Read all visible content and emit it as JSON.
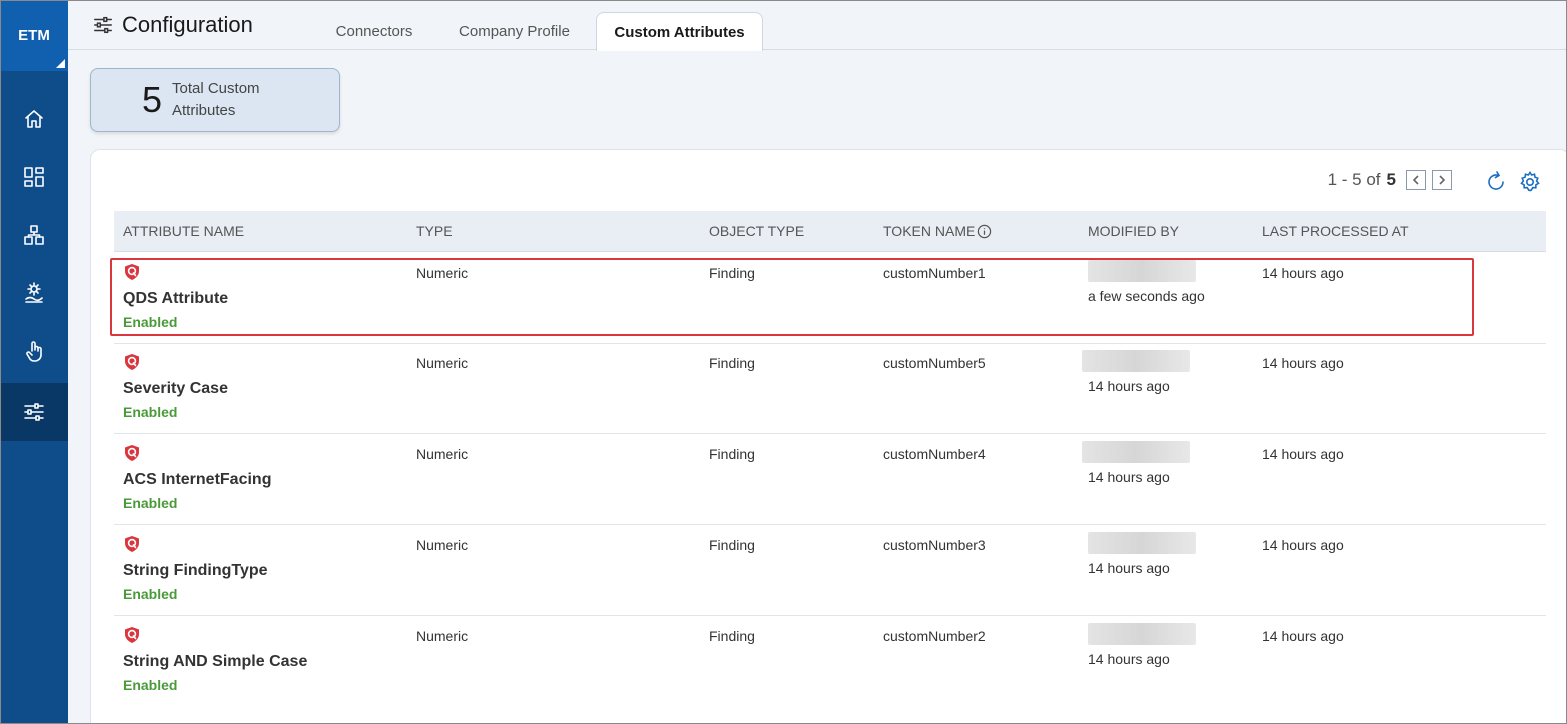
{
  "brand": "ETM",
  "header": {
    "title": "Configuration"
  },
  "tabs": [
    {
      "label": "Connectors",
      "active": false
    },
    {
      "label": "Company Profile",
      "active": false
    },
    {
      "label": "Custom Attributes",
      "active": true
    }
  ],
  "stat": {
    "value": "5",
    "label": "Total Custom Attributes"
  },
  "pager": {
    "range": "1 - 5 of",
    "total": "5"
  },
  "columns": [
    "ATTRIBUTE NAME",
    "TYPE",
    "OBJECT TYPE",
    "TOKEN NAME",
    "MODIFIED BY",
    "LAST PROCESSED AT"
  ],
  "rows": [
    {
      "name": "QDS Attribute",
      "status": "Enabled",
      "type": "Numeric",
      "object_type": "Finding",
      "token": "customNumber1",
      "modified": "a few seconds ago",
      "processed": "14 hours ago"
    },
    {
      "name": "Severity Case",
      "status": "Enabled",
      "type": "Numeric",
      "object_type": "Finding",
      "token": "customNumber5",
      "modified": "14 hours ago",
      "processed": "14 hours ago"
    },
    {
      "name": "ACS InternetFacing",
      "status": "Enabled",
      "type": "Numeric",
      "object_type": "Finding",
      "token": "customNumber4",
      "modified": "14 hours ago",
      "processed": "14 hours ago"
    },
    {
      "name": "String FindingType",
      "status": "Enabled",
      "type": "Numeric",
      "object_type": "Finding",
      "token": "customNumber3",
      "modified": "14 hours ago",
      "processed": "14 hours ago"
    },
    {
      "name": "String AND Simple Case",
      "status": "Enabled",
      "type": "Numeric",
      "object_type": "Finding",
      "token": "customNumber2",
      "modified": "14 hours ago",
      "processed": "14 hours ago"
    }
  ],
  "colors": {
    "sidebar": "#0f4c8a",
    "accent": "#1a6dc0",
    "enabled": "#4a9a3a",
    "highlight": "#d9363e",
    "shield": "#d9363e"
  },
  "icons": {
    "nav": [
      "home-icon",
      "dashboard-icon",
      "assets-icon",
      "settings-hand-icon",
      "touch-icon",
      "sliders-icon"
    ],
    "pager": [
      "chevron-left-icon",
      "chevron-right-icon"
    ],
    "tools": [
      "refresh-icon",
      "gear-icon"
    ],
    "row": "qualys-shield-icon",
    "token_info": "info-icon"
  }
}
